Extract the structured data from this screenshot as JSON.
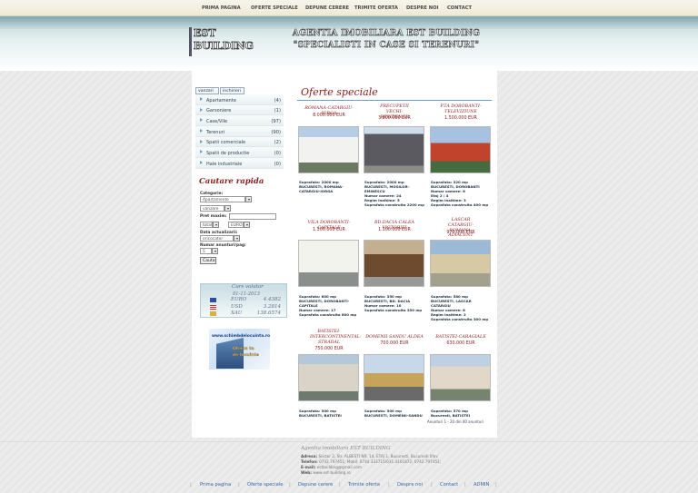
{
  "topnav": [
    "PRIMA PAGINA",
    "OFERTE SPECIALE",
    "DEPUNE CERERE",
    "TRIMITE OFERTA",
    "DESPRE NOI",
    "CONTACT"
  ],
  "header": {
    "logo_line1": "EST",
    "logo_line2": "BUILDING",
    "tagline1": "AGENTIA IMOBILIARA EST BUILDING",
    "tagline2": "\"SPECIALISTI IN CASE SI TERENURI\""
  },
  "sidebar": {
    "tabs": [
      "vanzari",
      "inchirieri"
    ],
    "categories": [
      {
        "label": "Apartamente",
        "count": "(4)"
      },
      {
        "label": "Garsoniere",
        "count": "(1)"
      },
      {
        "label": "Case/Vile",
        "count": "(97)"
      },
      {
        "label": "Terenuri",
        "count": "(90)"
      },
      {
        "label": "Spatii comerciale",
        "count": "(2)"
      },
      {
        "label": "Spatii de productie",
        "count": "(0)"
      },
      {
        "label": "Hale industriale",
        "count": "(0)"
      }
    ],
    "quick_search": {
      "title": "Cautare rapida",
      "categorie_label": "Categorie:",
      "categorie_value": "Apartamente",
      "tip_value": "vanzare",
      "pret_label": "Pret maxim:",
      "total_value": "total",
      "currency_value": "EURO",
      "date_label": "Data actualizarii:",
      "date_value": "oricocator",
      "per_page_label": "Numar anunturi/pag:",
      "per_page_value": "5",
      "search_button": "Cauta"
    },
    "currency": {
      "title": "Curs valutar",
      "date": "01-11-2013",
      "rates": [
        {
          "name": "EURO",
          "value": "4.4382",
          "flag": "eu"
        },
        {
          "name": "USD",
          "value": "3.2814",
          "flag": "us"
        },
        {
          "name": "XAU",
          "value": "138.6574",
          "flag": "gold"
        }
      ]
    },
    "ad": {
      "site": "www.schimbdelocuinta.ro",
      "line1": "Oferta ta",
      "line2": "de locuinte"
    }
  },
  "main": {
    "title": "Oferte speciale",
    "offers": [
      {
        "title": "ROMANA-CATARGIU-IORGA",
        "price": "8.000.000 EUR",
        "details": [
          "Suprafata: 2000 mp",
          "BUCURESTI, ROMANA-",
          "CATARGIU-IORGA"
        ]
      },
      {
        "title": "PRECUPETII VECHI-RESIDENCE",
        "price": "3.800.000 EUR",
        "details": [
          "Suprafata: 2000 mp",
          "BUCURESTI, MOSILOR-",
          "EMINESCU",
          "Numar camere: 24",
          "Regim inaltime: 5",
          "Suprafata construita 2200 mp"
        ]
      },
      {
        "title": "P.TA DOROBANTI-TELEVIZIUNE",
        "price": "1.500.000 EUR",
        "details": [
          "Suprafata: 320 mp",
          "BUCURESTI, DOROBANTI",
          "Numar camere: 6",
          "Etaj 2 / 4",
          "Regim inaltime: 3",
          "Suprafata construita 400 mp"
        ]
      },
      {
        "title": "VILA DOROBANTI-CAPITALE",
        "price": "1.300.000 EUR",
        "details": [
          "Suprafata: 600 mp",
          "BUCURESTI, DOROBANTI-",
          "CAPITALE",
          "Numar camere: 17",
          "Suprafata construita 600 mp"
        ]
      },
      {
        "title": "BD.DACIA-CALEA VICTORIEI",
        "price": "1.100.000 EUR",
        "details": [
          "Suprafata: 350 mp",
          "BUCURESTI, BD. DACIA",
          "Numar camere: 10",
          "Suprafata construita 350 mp"
        ]
      },
      {
        "title": "LASCAR CATARGIU-ROMANA-ADIACENT",
        "price": "970.000 EUR",
        "details": [
          "Suprafata: 580 mp",
          "BUCURESTI, LASCAR",
          "CATARGIU",
          "Numar camere: 8",
          "Regim inaltime: 2",
          "Suprafata construita 300 mp"
        ]
      },
      {
        "title": "BATISTEI-INTERCONTINENTAL-STRADAL",
        "price": "750.000 EUR",
        "details": [
          "Suprafata: 500 mp",
          "BUCURESTI, BATISTEI"
        ]
      },
      {
        "title": "DOMENII-SANDU ALDEA",
        "price": "700.000 EUR",
        "details": [
          "Suprafata: 500 mp",
          "BUCURESTI, DOMENII-SANDU"
        ]
      },
      {
        "title": "BATISTEI-CARAGIALE",
        "price": "630.000 EUR",
        "details": [
          "Suprafata: 570 mp",
          "Bucuresti, BATISTEI"
        ]
      }
    ],
    "anunturi": "Anunturi 1 - 20 din 40 anunturi"
  },
  "footer": {
    "company": "Agentia imobiliara EST BUILDING",
    "address_label": "Adresa:",
    "address": "Sector 2, Str. ALBESTI NR. 14, ETAJ 1, Bucuresti, Bucuresti Ilfov",
    "phone_label": "Telefon:",
    "phone": "0742.797451; Mobil: 0744.333715/031.4101872; 0742.797451;",
    "email_label": "E-mail:",
    "email": "estbuilding@gmail.com",
    "web_label": "Web:",
    "web": "www.est-building.ro",
    "nav": [
      "Prima pagina",
      "Oferte speciale",
      "Depune cerere",
      "Trimite oferta",
      "Despre noi",
      "Contact",
      "ADMIN"
    ]
  }
}
